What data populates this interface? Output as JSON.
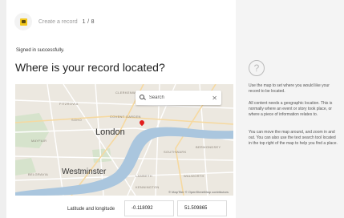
{
  "header": {
    "title": "Create a record",
    "step": "1 / 8"
  },
  "signin_message": "Signed in successfully.",
  "question": "Where is your record located?",
  "map": {
    "search_placeholder": "Search",
    "clear_icon": "✕",
    "labels": {
      "london": "London",
      "westminster": "Westminster",
      "fitzrovia": "FITZROVIA",
      "hoxton": "HOXTON",
      "clerkenwell": "CLERKENWELL",
      "soho": "SOHO",
      "covent_garden": "COVENT GARDEN",
      "southwark": "SOUTHWARK",
      "mayfair": "MAYFAIR",
      "lambeth": "LAMBETH",
      "belgravia": "BELGRAVIA",
      "bermondsey": "BERMONDSEY",
      "kennington": "KENNINGTON",
      "walworth": "WALWORTH"
    },
    "attribution": "© MapTiler © OpenStreetMap contributors"
  },
  "coordinates": {
    "label": "Latitude and longitude",
    "longitude": "-0.118092",
    "latitude": "51.509865"
  },
  "help": {
    "icon": "?",
    "paragraphs": [
      "Use the map to set where you would like your record to be located.",
      "All content needs a geographic location. This is normally where an event or story took place, or where a piece of information relates to.",
      "You can move the map around, and zoom in and out. You can also use the text search tool located in the top right of the map to help you find a place."
    ]
  }
}
